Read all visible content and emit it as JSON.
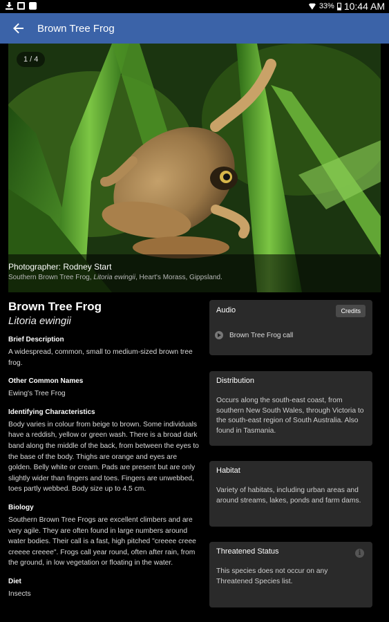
{
  "status_bar": {
    "battery": "33%",
    "time": "10:44 AM"
  },
  "app_bar": {
    "title": "Brown Tree Frog"
  },
  "gallery": {
    "counter": "1 / 4",
    "photographer": "Photographer: Rodney Start",
    "caption_prefix": "Southern Brown Tree Frog, ",
    "caption_italic": "Litoria ewingii",
    "caption_suffix": ", Heart's Morass, Gippsland."
  },
  "species": {
    "common_name": "Brown Tree Frog",
    "scientific_name": "Litoria ewingii",
    "sections": [
      {
        "heading": "Brief Description",
        "body": "A widespread, common, small to medium-sized brown tree frog."
      },
      {
        "heading": "Other Common Names",
        "body": "Ewing's Tree Frog"
      },
      {
        "heading": "Identifying Characteristics",
        "body": "Body varies in colour from beige to brown. Some individuals have a reddish, yellow or green wash. There is a broad dark band along the middle of the back, from between the eyes to the base of the body. Thighs are orange and eyes are golden. Belly white or cream. Pads are present but are only slightly wider than fingers and toes. Fingers are unwebbed, toes partly webbed. Body size up to 4.5 cm."
      },
      {
        "heading": "Biology",
        "body": "Southern Brown Tree Frogs are excellent climbers and are very agile. They are often found in large numbers around water bodies. Their call is a fast, high pitched \"creeee creee creeee creeee\". Frogs call year round, often after rain, from the ground, in low vegetation or floating in the water."
      },
      {
        "heading": "Diet",
        "body": "Insects"
      }
    ]
  },
  "audio": {
    "heading": "Audio",
    "credits_label": "Credits",
    "track": "Brown Tree Frog call"
  },
  "distribution": {
    "heading": "Distribution",
    "body": "Occurs along the south-east coast, from southern New South Wales, through Victoria to the south-east region of South Australia. Also found in Tasmania."
  },
  "habitat": {
    "heading": "Habitat",
    "body": "Variety of habitats, including urban areas and around streams, lakes, ponds and farm dams."
  },
  "threatened": {
    "heading": "Threatened Status",
    "info_icon": "i",
    "body": "This species does not occur on any Threatened Species list."
  }
}
